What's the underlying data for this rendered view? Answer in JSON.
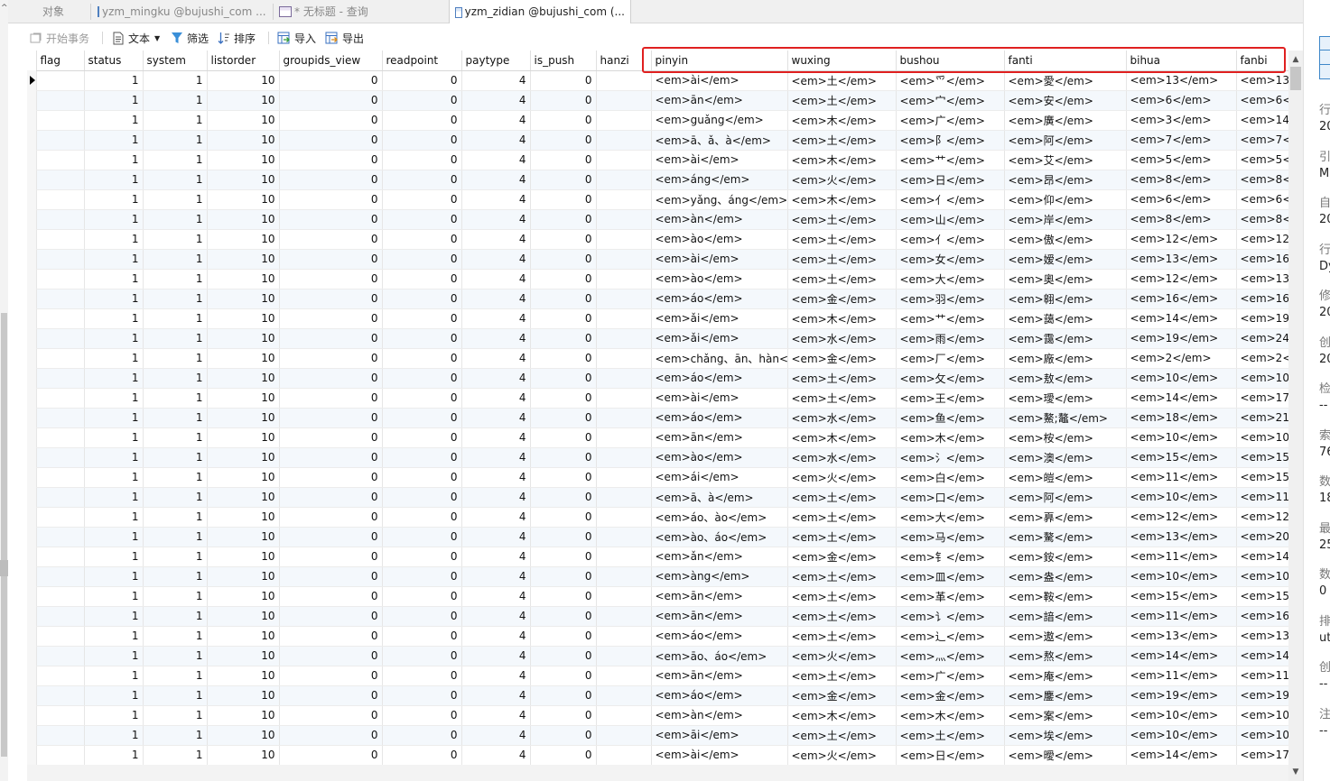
{
  "tabs": [
    {
      "label": "对象",
      "icon": ""
    },
    {
      "label": "yzm_mingku @bujushi_com ...",
      "icon": "table"
    },
    {
      "label": "* 无标题 - 查询",
      "icon": "query"
    },
    {
      "label": "yzm_zidian @bujushi_com (...",
      "icon": "table",
      "active": true
    }
  ],
  "toolbar": {
    "begin_transaction": "开始事务",
    "text": "文本",
    "filter": "筛选",
    "sort": "排序",
    "import": "导入",
    "export": "导出"
  },
  "columns": [
    "flag",
    "status",
    "system",
    "listorder",
    "groupids_view",
    "readpoint",
    "paytype",
    "is_push",
    "hanzi",
    "pinyin",
    "wuxing",
    "bushou",
    "fanti",
    "bihua",
    "fanbi"
  ],
  "defaults": {
    "flag": "",
    "status": "1",
    "system": "1",
    "listorder": "10",
    "groupids_view": "0",
    "readpoint": "0",
    "paytype": "4",
    "is_push": "0",
    "hanzi": ""
  },
  "rows": [
    [
      "<em>ài</em>",
      "<em>土</em>",
      "<em>爫</em>",
      "<em>愛</em>",
      "<em>13</em>",
      "<em>13"
    ],
    [
      "<em>ān</em>",
      "<em>土</em>",
      "<em>宀</em>",
      "<em>安</em>",
      "<em>6</em>",
      "<em>6<"
    ],
    [
      "<em>guǎng</em>",
      "<em>木</em>",
      "<em>广</em>",
      "<em>廣</em>",
      "<em>3</em>",
      "<em>14"
    ],
    [
      "<em>ā、ǎ、à</em>",
      "<em>土</em>",
      "<em>阝</em>",
      "<em>阿</em>",
      "<em>7</em>",
      "<em>7<"
    ],
    [
      "<em>ài</em>",
      "<em>木</em>",
      "<em>艹</em>",
      "<em>艾</em>",
      "<em>5</em>",
      "<em>5<"
    ],
    [
      "<em>áng</em>",
      "<em>火</em>",
      "<em>日</em>",
      "<em>昂</em>",
      "<em>8</em>",
      "<em>8<"
    ],
    [
      "<em>yǎng、áng</em>",
      "<em>木</em>",
      "<em>亻</em>",
      "<em>仰</em>",
      "<em>6</em>",
      "<em>6<"
    ],
    [
      "<em>àn</em>",
      "<em>土</em>",
      "<em>山</em>",
      "<em>岸</em>",
      "<em>8</em>",
      "<em>8<"
    ],
    [
      "<em>ào</em>",
      "<em>土</em>",
      "<em>亻</em>",
      "<em>傲</em>",
      "<em>12</em>",
      "<em>12"
    ],
    [
      "<em>ài</em>",
      "<em>土</em>",
      "<em>女</em>",
      "<em>嫒</em>",
      "<em>13</em>",
      "<em>16"
    ],
    [
      "<em>ào</em>",
      "<em>土</em>",
      "<em>大</em>",
      "<em>奧</em>",
      "<em>12</em>",
      "<em>13"
    ],
    [
      "<em>áo</em>",
      "<em>金</em>",
      "<em>羽</em>",
      "<em>翱</em>",
      "<em>16</em>",
      "<em>16"
    ],
    [
      "<em>ǎi</em>",
      "<em>木</em>",
      "<em>艹</em>",
      "<em>藹</em>",
      "<em>14</em>",
      "<em>19"
    ],
    [
      "<em>ǎi</em>",
      "<em>水</em>",
      "<em>雨</em>",
      "<em>靄</em>",
      "<em>19</em>",
      "<em>24"
    ],
    [
      "<em>chǎng、ān、hàn</em>",
      "<em>金</em>",
      "<em>厂</em>",
      "<em>廠</em>",
      "<em>2</em>",
      "<em>2<"
    ],
    [
      "<em>áo</em>",
      "<em>土</em>",
      "<em>攵</em>",
      "<em>敖</em>",
      "<em>10</em>",
      "<em>10"
    ],
    [
      "<em>ài</em>",
      "<em>土</em>",
      "<em>王</em>",
      "<em>璦</em>",
      "<em>14</em>",
      "<em>17"
    ],
    [
      "<em>áo</em>",
      "<em>水</em>",
      "<em>鱼</em>",
      "<em>鰲;鼇</em>",
      "<em>18</em>",
      "<em>21"
    ],
    [
      "<em>ān</em>",
      "<em>木</em>",
      "<em>木</em>",
      "<em>桉</em>",
      "<em>10</em>",
      "<em>10"
    ],
    [
      "<em>ào</em>",
      "<em>水</em>",
      "<em>氵</em>",
      "<em>澳</em>",
      "<em>15</em>",
      "<em>15"
    ],
    [
      "<em>ái</em>",
      "<em>火</em>",
      "<em>白</em>",
      "<em>皚</em>",
      "<em>11</em>",
      "<em>15"
    ],
    [
      "<em>ā、à</em>",
      "<em>土</em>",
      "<em>口</em>",
      "<em>阿</em>",
      "<em>10</em>",
      "<em>11"
    ],
    [
      "<em>áo、ào</em>",
      "<em>土</em>",
      "<em>大</em>",
      "<em>奡</em>",
      "<em>12</em>",
      "<em>12"
    ],
    [
      "<em>ào、áo</em>",
      "<em>土</em>",
      "<em>马</em>",
      "<em>驁</em>",
      "<em>13</em>",
      "<em>20"
    ],
    [
      "<em>ǎn</em>",
      "<em>金</em>",
      "<em>钅</em>",
      "<em>銨</em>",
      "<em>11</em>",
      "<em>14"
    ],
    [
      "<em>àng</em>",
      "<em>土</em>",
      "<em>皿</em>",
      "<em>盎</em>",
      "<em>10</em>",
      "<em>10"
    ],
    [
      "<em>ān</em>",
      "<em>土</em>",
      "<em>革</em>",
      "<em>鞍</em>",
      "<em>15</em>",
      "<em>15"
    ],
    [
      "<em>ān</em>",
      "<em>土</em>",
      "<em>讠</em>",
      "<em>諳</em>",
      "<em>11</em>",
      "<em>16"
    ],
    [
      "<em>áo</em>",
      "<em>土</em>",
      "<em>辶</em>",
      "<em>遨</em>",
      "<em>13</em>",
      "<em>13"
    ],
    [
      "<em>āo、áo</em>",
      "<em>火</em>",
      "<em>灬</em>",
      "<em>熬</em>",
      "<em>14</em>",
      "<em>14"
    ],
    [
      "<em>ān</em>",
      "<em>土</em>",
      "<em>广</em>",
      "<em>庵</em>",
      "<em>11</em>",
      "<em>11"
    ],
    [
      "<em>áo</em>",
      "<em>金</em>",
      "<em>金</em>",
      "<em>鏖</em>",
      "<em>19</em>",
      "<em>19"
    ],
    [
      "<em>àn</em>",
      "<em>木</em>",
      "<em>木</em>",
      "<em>案</em>",
      "<em>10</em>",
      "<em>10"
    ],
    [
      "<em>āi</em>",
      "<em>土</em>",
      "<em>土</em>",
      "<em>埃</em>",
      "<em>10</em>",
      "<em>10"
    ],
    [
      "<em>ài</em>",
      "<em>火</em>",
      "<em>日</em>",
      "<em>曖</em>",
      "<em>14</em>",
      "<em>17"
    ]
  ],
  "right_panel": [
    {
      "label": "行",
      "value": "20"
    },
    {
      "label": "引",
      "value": "M"
    },
    {
      "label": "自",
      "value": "20"
    },
    {
      "label": "行",
      "value": "Dy"
    },
    {
      "label": "修",
      "value": "20"
    },
    {
      "label": "创",
      "value": "20"
    },
    {
      "label": "检",
      "value": "--"
    },
    {
      "label": "索",
      "value": "76"
    },
    {
      "label": "数",
      "value": "18"
    },
    {
      "label": "最",
      "value": "25"
    },
    {
      "label": "数",
      "value": "0"
    },
    {
      "label": "排",
      "value": "ut"
    },
    {
      "label": "创",
      "value": "--"
    },
    {
      "label": "注",
      "value": "--"
    }
  ]
}
